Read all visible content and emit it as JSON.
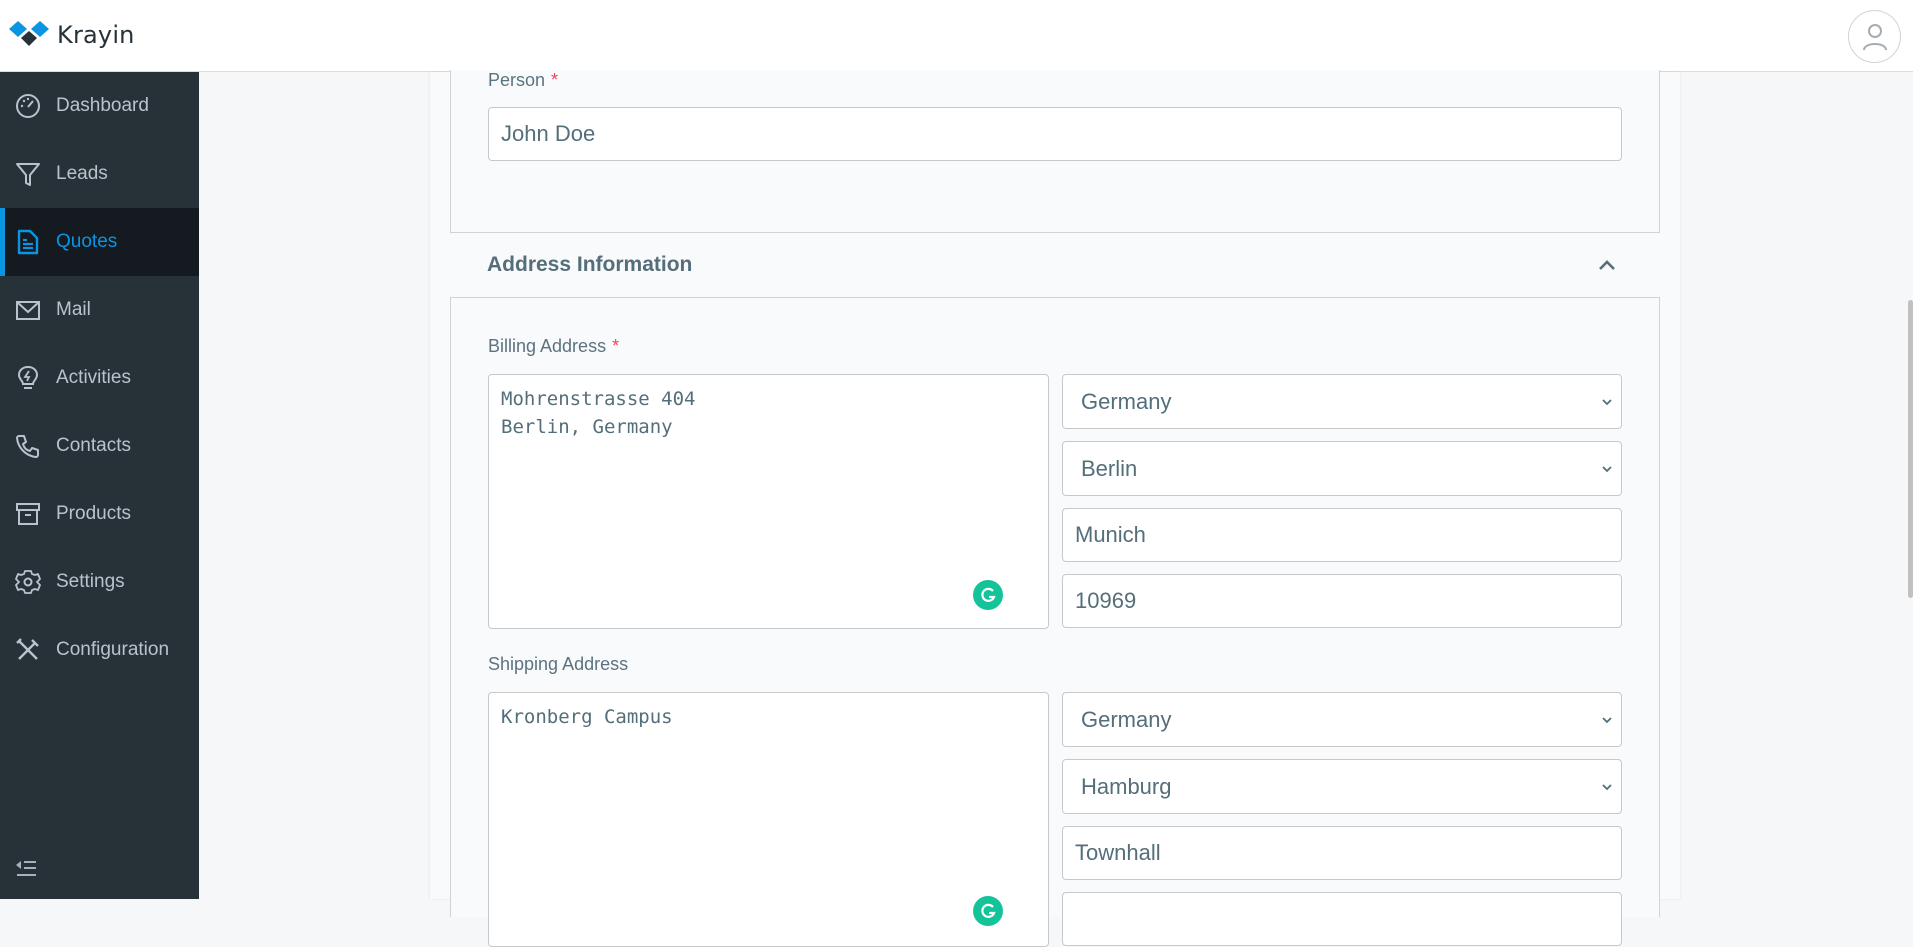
{
  "app": {
    "name": "Krayin",
    "brand_color": "#0a94e1"
  },
  "header": {
    "user_avatar_icon": "user-circle-icon"
  },
  "sidebar": {
    "items": [
      {
        "label": "Dashboard",
        "icon": "dashboard-gauge-icon",
        "active": false
      },
      {
        "label": "Leads",
        "icon": "funnel-icon",
        "active": false
      },
      {
        "label": "Quotes",
        "icon": "document-icon",
        "active": true
      },
      {
        "label": "Mail",
        "icon": "mail-icon",
        "active": false
      },
      {
        "label": "Activities",
        "icon": "lightbulb-icon",
        "active": false
      },
      {
        "label": "Contacts",
        "icon": "phone-icon",
        "active": false
      },
      {
        "label": "Products",
        "icon": "archive-box-icon",
        "active": false
      },
      {
        "label": "Settings",
        "icon": "gear-icon",
        "active": false
      },
      {
        "label": "Configuration",
        "icon": "tools-icon",
        "active": false
      }
    ],
    "collapse_icon": "collapse-menu-icon"
  },
  "form": {
    "person": {
      "label": "Person",
      "required_mark": "*",
      "value": "John Doe"
    },
    "address_section": {
      "title": "Address Information",
      "expanded": true
    },
    "billing": {
      "label": "Billing Address",
      "required_mark": "*",
      "address": "Mohrenstrasse 404\nBerlin, Germany",
      "country": "Germany",
      "state": "Berlin",
      "city": "Munich",
      "postcode": "10969"
    },
    "shipping": {
      "label": "Shipping Address",
      "address": "Kronberg Campus",
      "country": "Germany",
      "state": "Hamburg",
      "city": "Townhall",
      "postcode": ""
    }
  }
}
